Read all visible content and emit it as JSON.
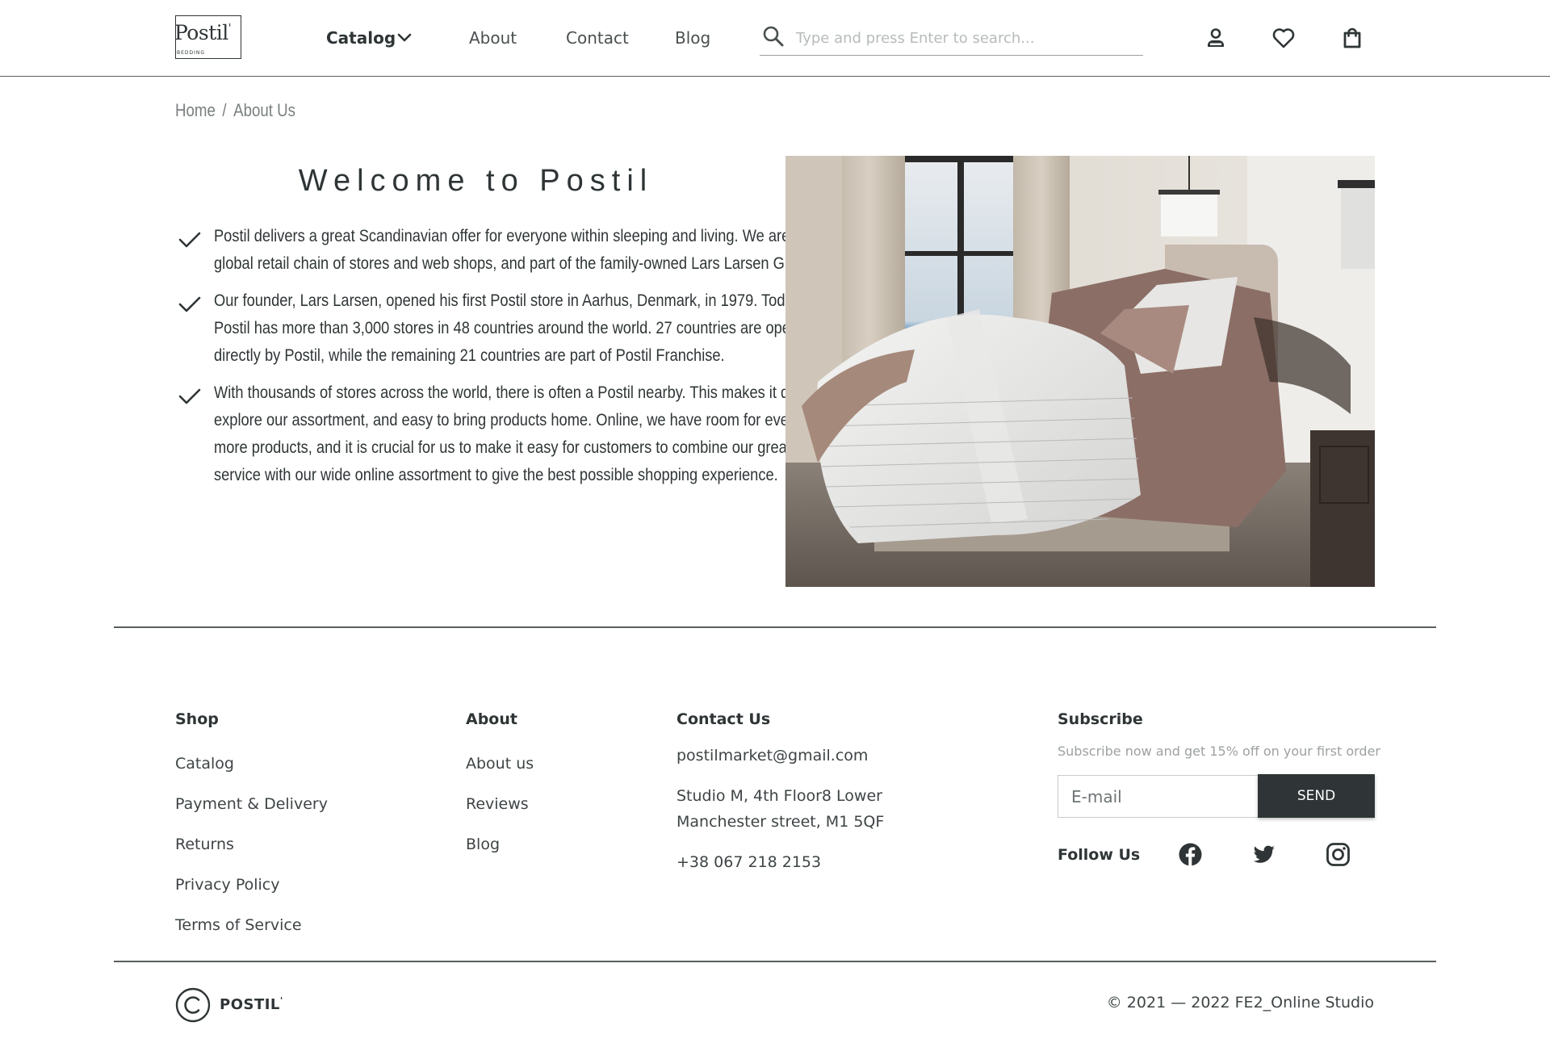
{
  "header": {
    "logo_text": "Postil",
    "logo_mark": "'",
    "logo_sub": "BEDDING",
    "nav": {
      "catalog": "Catalog",
      "about": "About",
      "contact": "Contact",
      "blog": "Blog"
    },
    "search_placeholder": "Type and press Enter to search..."
  },
  "breadcrumb": {
    "home": "Home",
    "separator": "/",
    "current": "About Us"
  },
  "main": {
    "title": "Welcome to Postil",
    "points": [
      "Postil delivers a great Scandinavian offer for everyone within sleeping and living. We are a global retail chain of stores and web shops, and part of the family-owned Lars Larsen Group.",
      "Our founder, Lars Larsen, opened his first Postil store in Aarhus, Denmark, in 1979. Today, Postil has more than 3,000 stores in 48 countries around the world. 27 countries are operated directly by Postil, while the remaining 21 countries are part of Postil Franchise.",
      "With thousands of stores across the world, there is often a Postil nearby. This makes it quick to explore our assortment, and easy to bring products home. Online, we have room for even more products, and it is crucial for us to make it easy for customers to combine our great store service with our wide online assortment to give the best possible shopping experience."
    ]
  },
  "footer": {
    "shop": {
      "title": "Shop",
      "links": [
        "Catalog",
        "Payment & Delivery",
        "Returns",
        "Privacy Policy",
        "Terms of Service"
      ]
    },
    "about": {
      "title": "About",
      "links": [
        "About us",
        "Reviews",
        "Blog"
      ]
    },
    "contact": {
      "title": "Contact Us",
      "email": "postilmarket@gmail.com",
      "address_line1": "Studio M, 4th Floor8 Lower",
      "address_line2": "Manchester street, M1 5QF",
      "phone": "+38 067 218 2153"
    },
    "subscribe": {
      "title": "Subscribe",
      "text": "Subscribe now and get 15% off on your first order",
      "email_placeholder": "E-mail",
      "button": "SEND"
    },
    "follow": {
      "label": "Follow Us",
      "icons": [
        "facebook-icon",
        "twitter-icon",
        "instagram-icon"
      ]
    },
    "brand": "POSTIL",
    "brand_mark": "'",
    "copyright": "© 2021 — 2022 FE2_Online Studio"
  },
  "colors": {
    "primary": "#2f3536",
    "text": "#3e4445",
    "muted": "#9da1a2",
    "border": "#5a5f60"
  }
}
